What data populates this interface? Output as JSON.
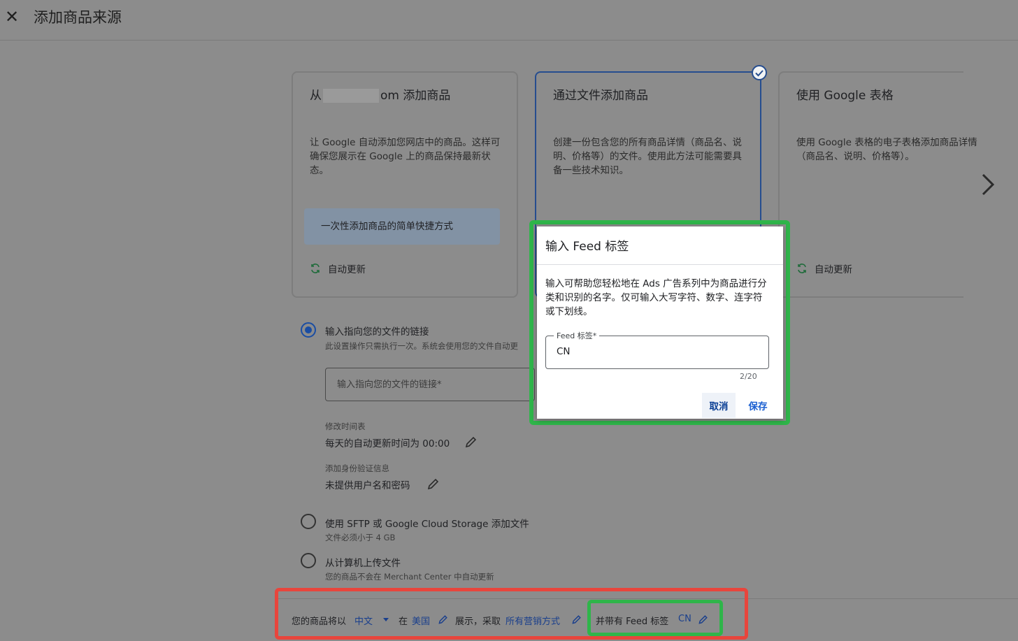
{
  "header": {
    "title": "添加商品来源"
  },
  "cards": [
    {
      "title_prefix": "从",
      "title_suffix": "om 添加商品",
      "desc": "让 Google 自动添加您网店中的商品。这样可确保您展示在 Google 上的商品保持最新状态。",
      "chip": "一次性添加商品的简单快捷方式",
      "foot": "自动更新"
    },
    {
      "title": "通过文件添加商品",
      "desc": "创建一份包含您的所有商品详情（商品名、说明、价格等）的文件。使用此方法可能需要具备一些技术知识。"
    },
    {
      "title": "使用 Google 表格",
      "desc": "使用 Google 表格的电子表格添加商品详情（商品名、说明、价格等）。",
      "foot": "自动更新"
    }
  ],
  "options": {
    "link": {
      "label": "输入指向您的文件的链接",
      "sub": "此设置操作只需执行一次。系统会使用您的文件自动更",
      "input_placeholder": "输入指向您的文件的链接*",
      "schedule_caption": "修改时间表",
      "schedule_value": "每天的自动更新时间为 00:00",
      "auth_caption": "添加身份验证信息",
      "auth_value": "未提供用户名和密码"
    },
    "sftp": {
      "label": "使用 SFTP 或 Google Cloud Storage 添加文件",
      "sub": "文件必须小于 4 GB"
    },
    "upload": {
      "label": "从计算机上传文件",
      "sub": "您的商品不会在 Merchant Center 中自动更新"
    }
  },
  "bottom": {
    "t1": "您的商品将以",
    "language": "中文",
    "t2": "在",
    "country": "美国",
    "t3": "展示，采取",
    "methods": "所有营销方式",
    "t4": "并带有 Feed 标签",
    "feed_label": "CN"
  },
  "dialog": {
    "title": "输入 Feed 标签",
    "body": "输入可帮助您轻松地在 Ads 广告系列中为商品进行分类和识别的名字。仅可输入大写字符、数字、连字符或下划线。",
    "field_label": "Feed 标签*",
    "field_value": "CN",
    "counter": "2/20",
    "cancel": "取消",
    "save": "保存"
  },
  "colors": {
    "selected_border": "#264d8f",
    "link": "#1a3f8c",
    "highlight_red": "#e8453c",
    "highlight_green": "#2fb54a"
  }
}
